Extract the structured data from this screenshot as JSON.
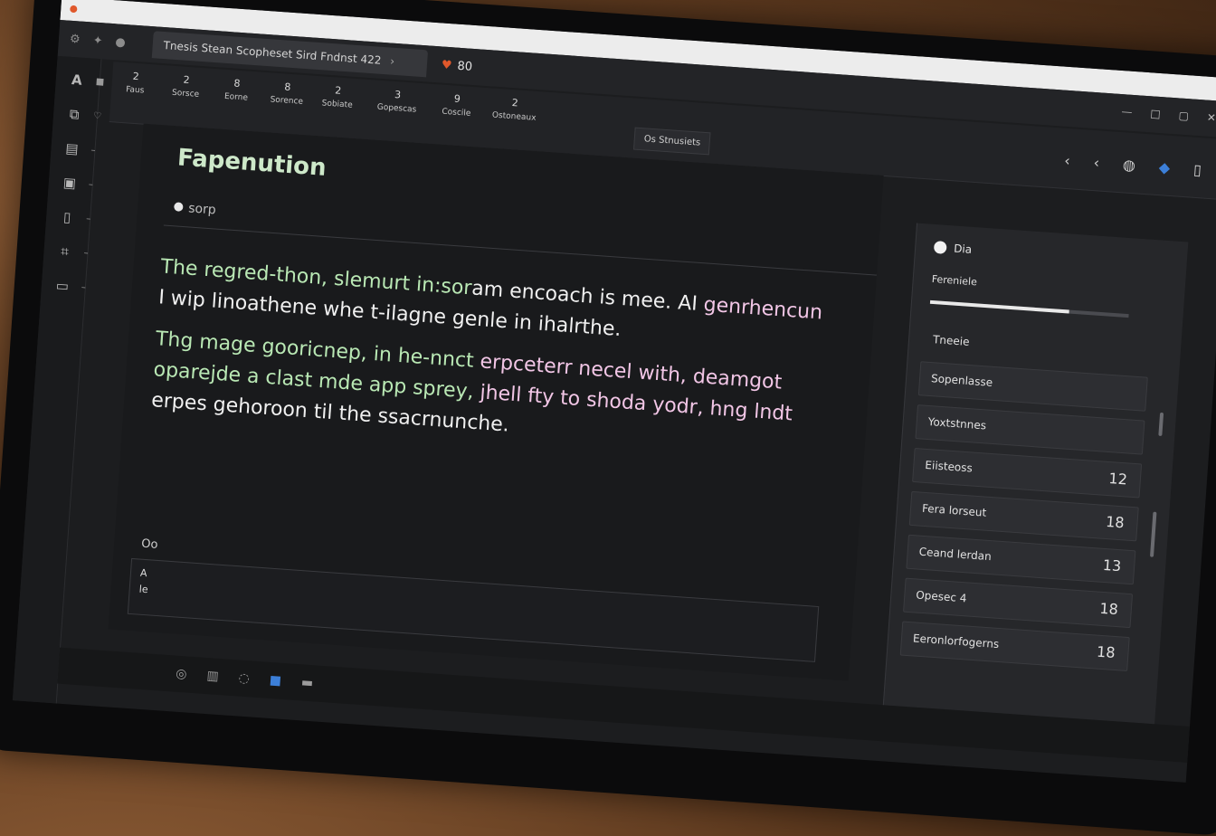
{
  "browser": {
    "url": ""
  },
  "tabbar": {
    "tab_title": "Tnesis Stean Scopheset Sird Fndnst 422",
    "heart_count": "80"
  },
  "ribbon": {
    "groups": [
      {
        "num": "2",
        "label": "Faus"
      },
      {
        "num": "2",
        "label": "Sorsce"
      },
      {
        "num": "8",
        "label": "Eorne"
      },
      {
        "num": "8",
        "label": "Sorence"
      },
      {
        "num": "2",
        "label": "Sobiate"
      },
      {
        "num": "3",
        "label": "Gopescas"
      },
      {
        "num": "9",
        "label": "Coscile"
      },
      {
        "num": "2",
        "label": "Ostoneaux"
      }
    ],
    "tag": "Os Stnusiets"
  },
  "doc": {
    "title": "Fapenution",
    "subtitle": "sorp",
    "paragraph1_line1": "The regred-thon, slemurt in:sor",
    "paragraph1_line1b": "am encoach is mee. AI",
    "paragraph1_line1c": " genrhencun",
    "paragraph1_line2": "I wip linoathene whe t-ilagne genle in ihalrthe.",
    "paragraph2_line1": "Thg mage gooricnep, in he-nnct ",
    "paragraph2_line1b": "erpceterr necel with, deamgot",
    "paragraph2_line2": "oparejde a clast mde app sprey, ",
    "paragraph2_line2b": "jhell fty to shoda yodr, hng lndt",
    "paragraph2_line3": "erpes gehoroon til the ssacrnunche.",
    "footer_label": "Oo",
    "box_line1": "A",
    "box_line2": "le"
  },
  "panel": {
    "head": "Dia",
    "label": "Fereniele",
    "slider_value": 0.7,
    "rows": [
      {
        "label": "Tneeie",
        "value": ""
      },
      {
        "label": "Sopenlasse",
        "value": ""
      },
      {
        "label": "Yoxtstnnes",
        "value": ""
      },
      {
        "label": "Eiisteoss",
        "value": "12"
      },
      {
        "label": "Fera lorseut",
        "value": "18"
      },
      {
        "label": "Ceand lerdan",
        "value": "13"
      },
      {
        "label": "Opesec 4",
        "value": "18"
      },
      {
        "label": "Eeronlorfogerns",
        "value": "18"
      }
    ]
  }
}
